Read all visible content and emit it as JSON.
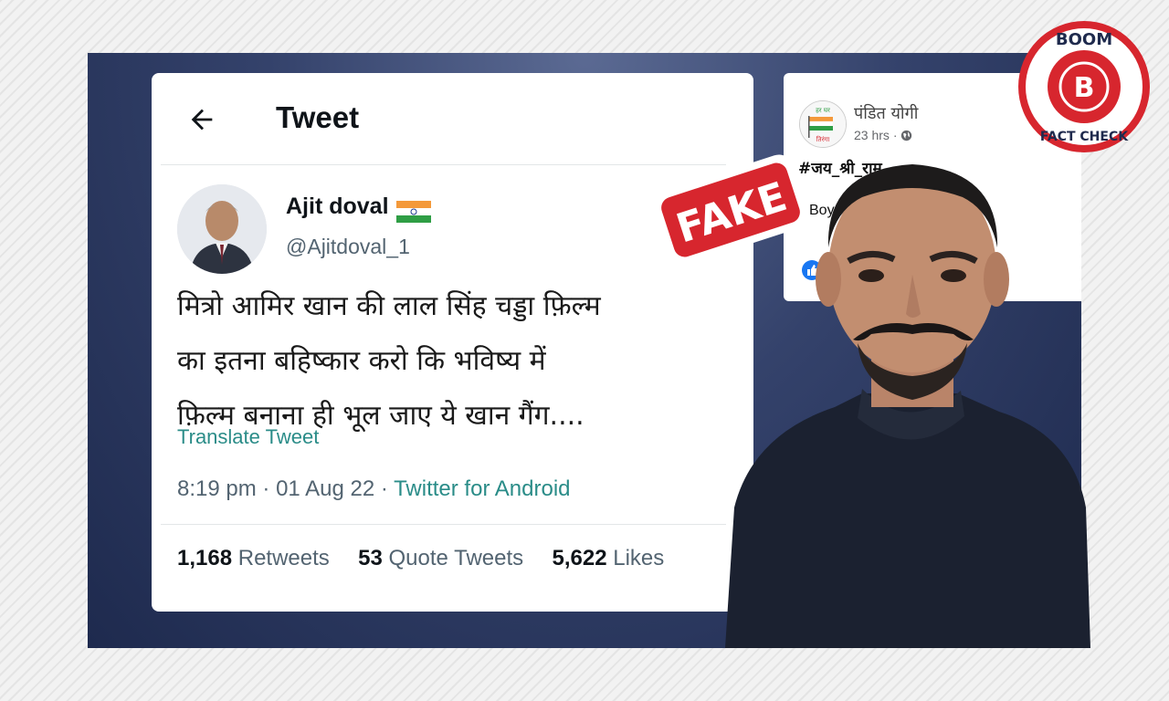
{
  "tweet": {
    "header_title": "Tweet",
    "author_name": "Ajit doval",
    "handle": "@Ajitdoval_1",
    "text_lines": [
      "मित्रो आमिर खान की लाल सिंह चड्डा फ़िल्म",
      "का इतना बहिष्कार करो कि भविष्य में",
      "फ़िल्म बनाना ही भूल जाए ये खान गैंग...."
    ],
    "translate_label": "Translate Tweet",
    "time": "8:19 pm",
    "date": "01 Aug 22",
    "source": "Twitter for Android",
    "separator": "·",
    "stats": {
      "retweets_count": "1,168",
      "retweets_label": "Retweets",
      "quotes_count": "53",
      "quotes_label": "Quote Tweets",
      "likes_count": "5,622",
      "likes_label": "Likes"
    }
  },
  "facebook_post": {
    "page_name": "पंडित योगी",
    "time": "23 hrs",
    "separator": "·",
    "hashtag": "#जय_श्री_राम",
    "text_partial": "Boyc",
    "avatar_caption_top": "हर घर",
    "avatar_caption_bottom": "तिरंगा"
  },
  "stamps": {
    "fake_label": "FAKE",
    "badge_top": "BOOM",
    "badge_letter": "B",
    "badge_bottom": "FACT CHECK"
  },
  "icons": {
    "back": "back-arrow-icon",
    "flag": "india-flag-icon",
    "globe": "globe-icon",
    "like": "like-icon",
    "love": "love-icon"
  },
  "colors": {
    "accent_link": "#2a8c88",
    "stamp_red": "#d7262e",
    "panel_navy": "#26335a"
  }
}
